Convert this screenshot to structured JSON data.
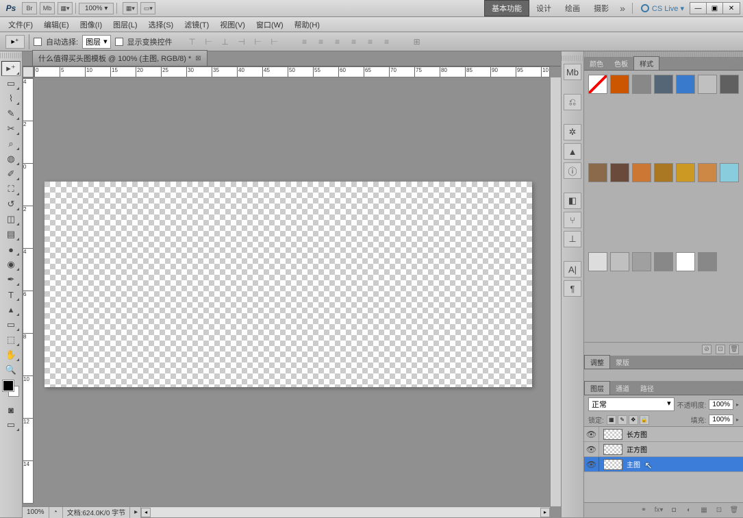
{
  "titlebar": {
    "logo": "Ps",
    "br": "Br",
    "mb": "Mb",
    "zoom": "100% ▾",
    "workspaces": [
      "基本功能",
      "设计",
      "绘画",
      "摄影"
    ],
    "active_workspace": 0,
    "more": "»",
    "cslive": "CS Live ▾",
    "win_min": "—",
    "win_max": "▣",
    "win_close": "✕"
  },
  "menu": [
    "文件(F)",
    "编辑(E)",
    "图像(I)",
    "图层(L)",
    "选择(S)",
    "滤镜(T)",
    "视图(V)",
    "窗口(W)",
    "帮助(H)"
  ],
  "options": {
    "auto_select": "自动选择:",
    "target_dropdown": "图层",
    "show_transform": "显示变换控件"
  },
  "doc": {
    "tab_title": "什么值得买头图模板 @ 100% (主图, RGB/8) *",
    "ruler_h": [
      "0",
      "5",
      "10",
      "15",
      "20",
      "25",
      "30",
      "35",
      "40",
      "45",
      "50",
      "55",
      "60",
      "65",
      "70",
      "75",
      "80",
      "85",
      "90",
      "95",
      "10"
    ],
    "ruler_v": [
      "4",
      "2",
      "0",
      "2",
      "4",
      "6",
      "8",
      "10",
      "12",
      "14"
    ],
    "status_zoom": "100%",
    "status_doc": "文档:624.0K/0 字节",
    "status_arrow": "▸"
  },
  "panels": {
    "styles": {
      "tabs": [
        "颜色",
        "色板",
        "样式"
      ],
      "active": 2
    },
    "adjust": {
      "tabs": [
        "调整",
        "蒙版"
      ],
      "active": 0
    },
    "layers": {
      "tabs": [
        "图层",
        "通道",
        "路径"
      ],
      "active": 0,
      "blend": "正常",
      "blend_arrow": "▾",
      "opacity_label": "不透明度:",
      "opacity_val": "100%",
      "lock_label": "锁定:",
      "fill_label": "填充:",
      "fill_val": "100%",
      "items": [
        {
          "name": "长方图",
          "selected": false
        },
        {
          "name": "正方图",
          "selected": false
        },
        {
          "name": "主图",
          "selected": true
        }
      ]
    }
  },
  "style_swatches": [
    "#ffffff",
    "#cc5500",
    "#888888",
    "#556677",
    "#3a7acc",
    "#c0c0c0",
    "#606060",
    "#8a6a4a",
    "#6a4a3a",
    "#cc7733",
    "#aa7722",
    "#cc9922",
    "#cc8844",
    "#88ccdd",
    "#dddddd",
    "#c0c0c0",
    "#a0a0a0",
    "#888888",
    "#ffffff",
    "#888888"
  ]
}
